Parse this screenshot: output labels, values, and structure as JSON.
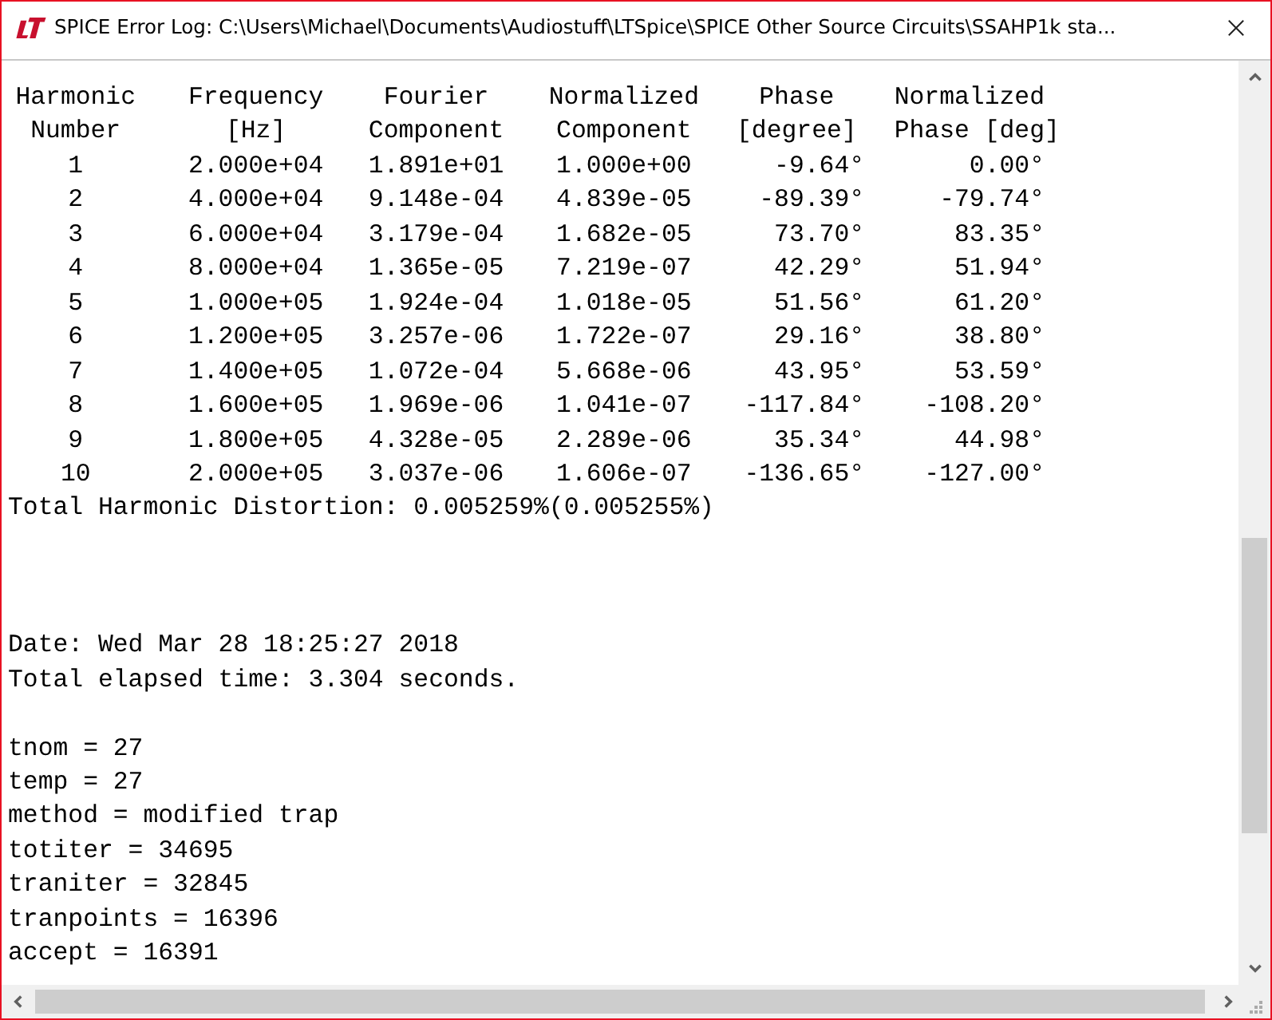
{
  "window": {
    "title": "SPICE Error Log: C:\\Users\\Michael\\Documents\\Audiostuff\\LTSpice\\SPICE Other Source Circuits\\SSAHP1k sta..."
  },
  "table": {
    "columns": [
      {
        "line1": "Harmonic",
        "line2": "Number"
      },
      {
        "line1": "Frequency",
        "line2": "[Hz]"
      },
      {
        "line1": "Fourier",
        "line2": "Component"
      },
      {
        "line1": "Normalized",
        "line2": "Component"
      },
      {
        "line1": "Phase",
        "line2": "[degree]"
      },
      {
        "line1": "Normalized",
        "line2": "Phase [deg]"
      }
    ],
    "rows": [
      [
        "1",
        "2.000e+04",
        "1.891e+01",
        "1.000e+00",
        "-9.64°",
        "0.00°"
      ],
      [
        "2",
        "4.000e+04",
        "9.148e-04",
        "4.839e-05",
        "-89.39°",
        "-79.74°"
      ],
      [
        "3",
        "6.000e+04",
        "3.179e-04",
        "1.682e-05",
        "73.70°",
        "83.35°"
      ],
      [
        "4",
        "8.000e+04",
        "1.365e-05",
        "7.219e-07",
        "42.29°",
        "51.94°"
      ],
      [
        "5",
        "1.000e+05",
        "1.924e-04",
        "1.018e-05",
        "51.56°",
        "61.20°"
      ],
      [
        "6",
        "1.200e+05",
        "3.257e-06",
        "1.722e-07",
        "29.16°",
        "38.80°"
      ],
      [
        "7",
        "1.400e+05",
        "1.072e-04",
        "5.668e-06",
        "43.95°",
        "53.59°"
      ],
      [
        "8",
        "1.600e+05",
        "1.969e-06",
        "1.041e-07",
        "-117.84°",
        "-108.20°"
      ],
      [
        "9",
        "1.800e+05",
        "4.328e-05",
        "2.289e-06",
        "35.34°",
        "44.98°"
      ],
      [
        "10",
        "2.000e+05",
        "3.037e-06",
        "1.606e-07",
        "-136.65°",
        "-127.00°"
      ]
    ]
  },
  "thd": "Total Harmonic Distortion: 0.005259%(0.005255%)",
  "log_sections": [
    [
      "Date: Wed Mar 28 18:25:27 2018",
      "Total elapsed time: 3.304 seconds."
    ],
    [
      "tnom = 27",
      "temp = 27",
      "method = modified trap",
      "totiter = 34695",
      "traniter = 32845",
      "tranpoints = 16396",
      "accept = 16391"
    ]
  ]
}
